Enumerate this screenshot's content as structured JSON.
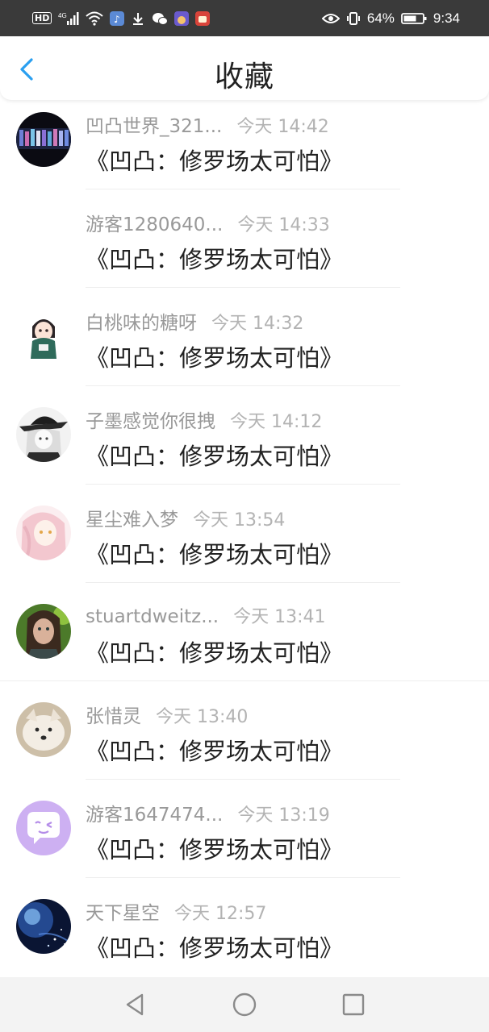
{
  "statusbar": {
    "network": "4G",
    "battery": "64%",
    "time": "9:34",
    "icons": [
      "hd-icon",
      "signal-icon",
      "wifi-icon",
      "music-app-icon",
      "download-icon",
      "wechat-icon",
      "app-notification-icon",
      "game-app-icon",
      "eye-comfort-icon",
      "vibrate-icon",
      "battery-icon"
    ]
  },
  "header": {
    "title": "收藏",
    "back_icon": "chevron-left-icon",
    "accent": "#2a9ff0"
  },
  "favorites": [
    {
      "name": "凹凸世界_321...",
      "time": "今天 14:42",
      "content": "《凹凸：修罗场太可怕》",
      "avatar": "anime-group-avatar"
    },
    {
      "name": "游客1280640...",
      "time": "今天 14:33",
      "content": "《凹凸：修罗场太可怕》",
      "avatar": "blank-avatar"
    },
    {
      "name": "白桃味的糖呀",
      "time": "今天 14:32",
      "content": "《凹凸：修罗场太可怕》",
      "avatar": "chibi-girl-avatar"
    },
    {
      "name": "子墨感觉你很拽",
      "time": "今天 14:12",
      "content": "《凹凸：修罗场太可怕》",
      "avatar": "hat-character-avatar"
    },
    {
      "name": "星尘难入梦",
      "time": "今天 13:54",
      "content": "《凹凸：修罗场太可怕》",
      "avatar": "pink-hair-avatar"
    },
    {
      "name": "stuartdweitz...",
      "time": "今天 13:41",
      "content": "《凹凸：修罗场太可怕》",
      "avatar": "child-portrait-avatar"
    },
    {
      "name": "张惜灵",
      "time": "今天 13:40",
      "content": "《凹凸：修罗场太可怕》",
      "avatar": "dog-avatar"
    },
    {
      "name": "游客1647474...",
      "time": "今天 13:19",
      "content": "《凹凸：修罗场太可怕》",
      "avatar": "default-chat-avatar"
    },
    {
      "name": "天下星空",
      "time": "今天 12:57",
      "content": "《凹凸：修罗场太可怕》",
      "avatar": "galaxy-avatar"
    }
  ],
  "navbar": {
    "back": "triangle-back-icon",
    "home": "circle-home-icon",
    "recent": "square-recent-icon"
  }
}
